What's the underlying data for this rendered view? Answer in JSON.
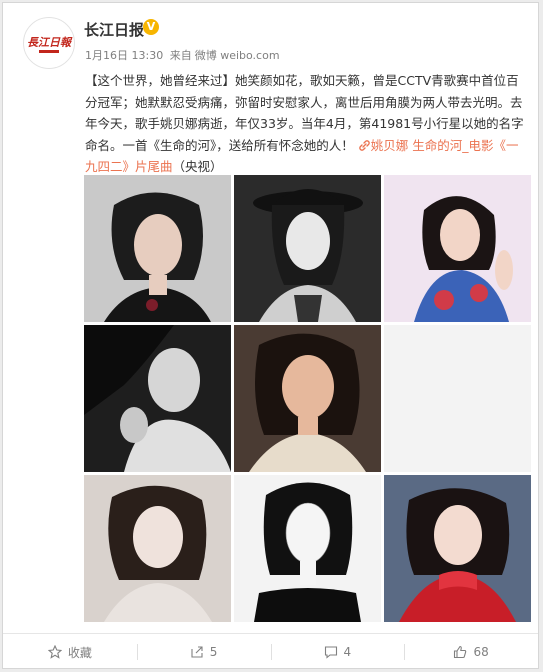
{
  "account": {
    "name": "长江日报",
    "avatar_text": "長江日報",
    "verified_icon": "v-verified-icon"
  },
  "meta": {
    "date": "1月16日 13:30",
    "from": "来自",
    "source": "微博 weibo.com"
  },
  "post": {
    "segments": [
      {
        "text": "【这个世界，她曾经来过】她笑颜如花，歌如天籁，曾是CCTV青歌赛中首位百分冠军；她默默忍受病痛，弥留时安慰家人，离世后用角膜为两人带去光明。去年今天，歌手姚贝娜病逝，年仅33岁。当年4月，第41981号小行星以她的名字命名。一首《生命的河》，送给所有怀念她的人！",
        "kind": "plain"
      },
      {
        "text": "姚贝娜 生命的河_电影《一九四二》片尾曲",
        "kind": "link"
      },
      {
        "text": "（央视）",
        "kind": "plain"
      }
    ]
  },
  "photos": [
    {
      "label": "photo-1",
      "watermark": ""
    },
    {
      "label": "photo-2",
      "watermark": ""
    },
    {
      "label": "photo-3",
      "watermark": ""
    },
    {
      "label": "photo-4",
      "watermark": ""
    },
    {
      "label": "photo-5",
      "watermark": ""
    },
    {
      "label": "photo-6",
      "watermark": ""
    },
    {
      "label": "photo-7",
      "watermark": ""
    },
    {
      "label": "photo-8",
      "watermark": ""
    },
    {
      "label": "photo-9",
      "watermark": ""
    }
  ],
  "footer": {
    "favorite_label": "收藏",
    "repost_count": "5",
    "comment_count": "4",
    "like_count": "68"
  },
  "colors": {
    "link": "#eb7350",
    "text": "#333333",
    "meta": "#808080",
    "verified": "#f7b500"
  }
}
